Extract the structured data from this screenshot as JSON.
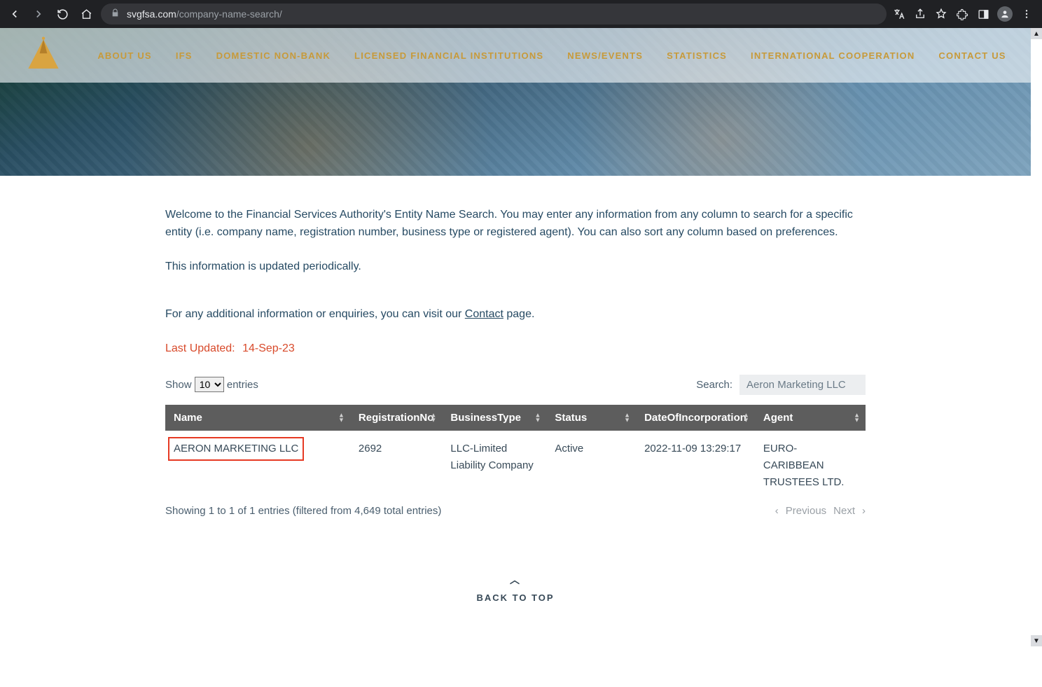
{
  "browser": {
    "url_domain": "svgfsa.com",
    "url_path": "/company-name-search/"
  },
  "nav": {
    "items": [
      "ABOUT US",
      "IFS",
      "DOMESTIC NON-BANK",
      "LICENSED FINANCIAL INSTITUTIONS",
      "NEWS/EVENTS",
      "STATISTICS",
      "INTERNATIONAL COOPERATION",
      "CONTACT US"
    ]
  },
  "intro": {
    "p1": "Welcome to the Financial Services Authority's Entity Name Search. You may enter any information from any column to search for a specific entity (i.e. company name, registration number, business type or registered agent). You can also sort any column based on preferences.",
    "p2": "This information is updated periodically.",
    "p3_before": "For any additional information or enquiries, you can visit our ",
    "p3_link": "Contact",
    "p3_after": " page."
  },
  "last_updated": {
    "label": "Last Updated:",
    "value": "14-Sep-23"
  },
  "datatable": {
    "show_label_before": "Show",
    "show_label_after": "entries",
    "show_value": "10",
    "search_label": "Search:",
    "search_value": "Aeron Marketing LLC",
    "columns": [
      "Name",
      "RegistrationNo",
      "BusinessType",
      "Status",
      "DateOfIncorporation",
      "Agent"
    ],
    "row": {
      "name": "AERON MARKETING LLC",
      "reg": "2692",
      "type": "LLC-Limited Liability Company",
      "status": "Active",
      "date": "2022-11-09 13:29:17",
      "agent": "EURO-CARIBBEAN TRUSTEES LTD."
    },
    "info": "Showing 1 to 1 of 1 entries (filtered from 4,649 total entries)",
    "prev": "Previous",
    "next": "Next"
  },
  "back_to_top": "BACK TO TOP"
}
